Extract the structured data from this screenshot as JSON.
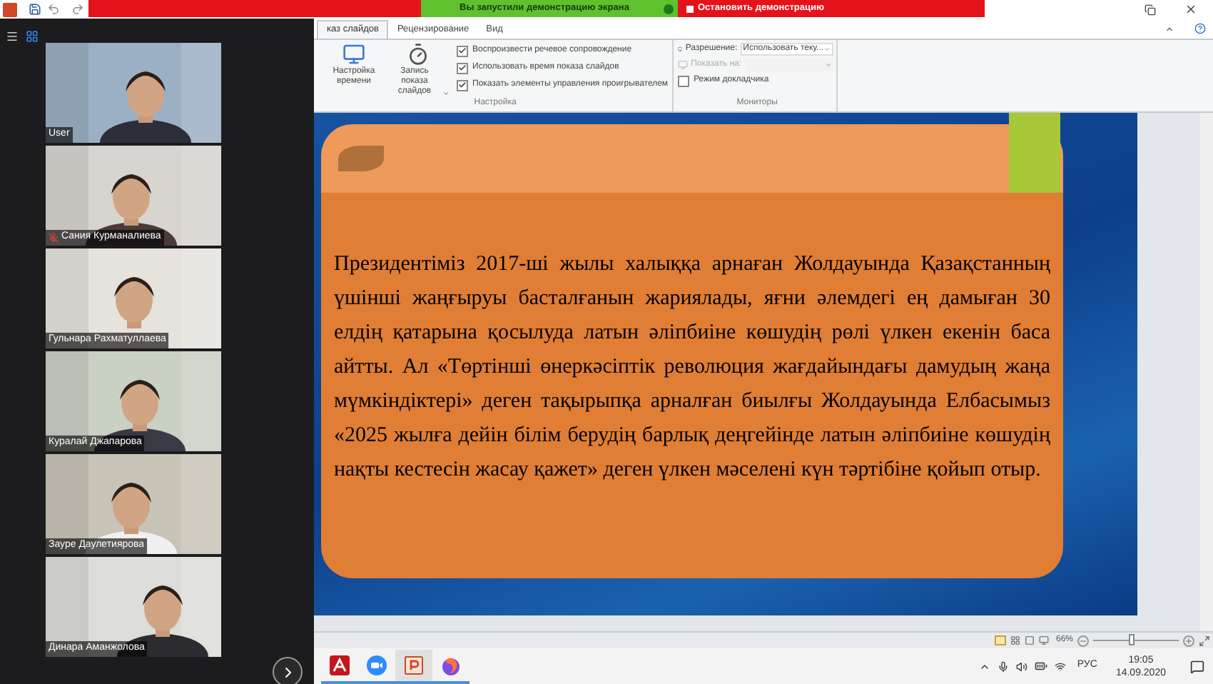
{
  "powerpoint": {
    "tabs": [
      {
        "label": "каз слайдов",
        "selected": true
      },
      {
        "label": "Рецензирование",
        "selected": false
      },
      {
        "label": "Вид",
        "selected": false
      }
    ],
    "settings_group": {
      "label": "Настройка",
      "buttons": [
        {
          "label": "Настройка времени",
          "kind": "timing"
        },
        {
          "label": "Запись показа слайдов",
          "kind": "record"
        }
      ],
      "checkboxes": [
        {
          "label": "Воспроизвести речевое сопровождение",
          "checked": true
        },
        {
          "label": "Использовать время показа слайдов",
          "checked": true
        },
        {
          "label": "Показать элементы управления проигрывателем",
          "checked": true
        }
      ]
    },
    "monitors_group": {
      "label": "Мониторы",
      "fields": [
        {
          "label": "Разрешение:",
          "value": "Использовать теку...",
          "disabled": false
        },
        {
          "label": "Показать на:",
          "disabled": true
        }
      ],
      "checkboxes": [
        {
          "label": "Режим докладчика",
          "checked": false
        }
      ]
    },
    "slide": {
      "text": "Президентіміз  2017-ші жылы халыққа арнаған Жолдауында Қазақстанның үшінші жаңғыруы басталғанын жариялады, яғни әлемдегі ең дамыған 30 елдің қатарына қосылуда латын әліпбиіне көшудің рөлі үлкен екенін баса айтты. Ал «Төртінші өнеркәсіптік революция жағдайындағы дамудың жаңа мүмкіндіктері» деген тақырыпқа арналған биылғы Жолдауында Елбасымыз «2025 жылға дейін білім берудің барлық деңгейінде латын әліпбиіне көшудің нақты кестесін жасау қажет» деген үлкен мәселені күн тәртібіне қойып отыр."
    },
    "status_bar": {
      "zoom": "66%",
      "level": 0.45
    }
  },
  "zoom_meeting": {
    "sharing_notice": "Вы запустили демонстрацию экрана",
    "stop_button": "Остановить демонстрацию",
    "participants": [
      {
        "name": "User",
        "muted": false
      },
      {
        "name": "Сания Курманалиева",
        "muted": true
      },
      {
        "name": "Гульнара Рахматуллаева",
        "muted": false
      },
      {
        "name": "Куралай Джапарова",
        "muted": false
      },
      {
        "name": "Зауре Даулетиярова",
        "muted": false
      },
      {
        "name": "Динара Аманжолова",
        "muted": false
      }
    ]
  },
  "taskbar": {
    "apps": [
      {
        "kind": "pdf",
        "selected": false
      },
      {
        "kind": "video",
        "selected": false
      },
      {
        "kind": "slides",
        "selected": true
      },
      {
        "kind": "browser",
        "selected": false
      }
    ],
    "language": "РУС",
    "time": "19:05",
    "date": "14.09.2020"
  }
}
